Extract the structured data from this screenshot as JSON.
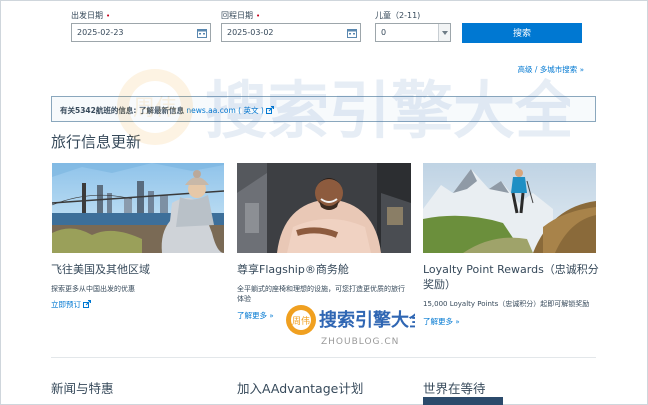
{
  "form": {
    "depart_label": "出发日期",
    "depart_value": "2025-02-23",
    "return_label": "回程日期",
    "return_value": "2025-03-02",
    "children_label": "儿童（2-11)",
    "children_value": "0",
    "search_label": "搜索",
    "required_mark": "•"
  },
  "advanced_link": "高级 / 多城市搜索",
  "chevron": "»",
  "alert": {
    "text_bold": "有关5342航班的信息: 了解最新信息",
    "link": "news.aa.com",
    "lang": "( 英文 )"
  },
  "section_title": "旅行信息更新",
  "cards": [
    {
      "title": "飞往美国及其他区域",
      "desc": "探索更多从中国出发的优惠",
      "link": "立即预订"
    },
    {
      "title": "尊享Flagship®商务舱",
      "desc": "全平躺式的座椅和理想的设施，可您打造更优质的旅行体验",
      "link": "了解更多"
    },
    {
      "title": "Loyalty Point Rewards（忠诚积分奖励）",
      "desc": "15,000 Loyalty Points（忠诚积分）起即可解锁奖励",
      "link": "了解更多"
    }
  ],
  "bottom": [
    "新闻与特惠",
    "加入AAdvantage计划",
    "世界在等待"
  ],
  "watermark": {
    "brand": "搜索引擎大全",
    "domain": "ZHOUBLOG.CN",
    "badge": "周伟"
  },
  "colors": {
    "accent": "#0078d2",
    "text": "#36495a",
    "required": "#c30019"
  }
}
